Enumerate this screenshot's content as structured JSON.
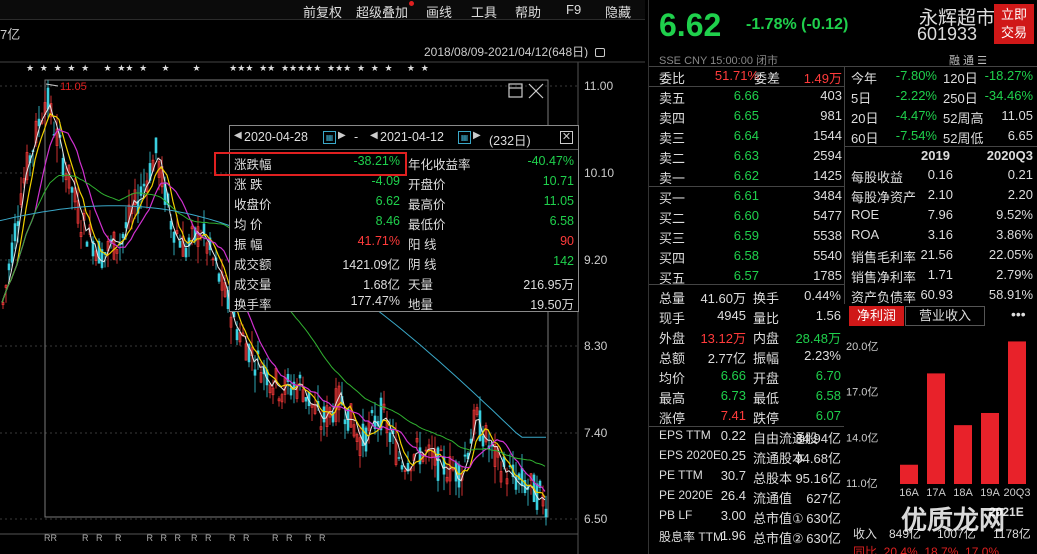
{
  "menu": [
    "前复权",
    "超级叠加",
    "画线",
    "工具",
    "帮助",
    "F9",
    "隐藏"
  ],
  "market_cap_label": "7亿",
  "date_range": "2018/08/09-2021/04/12(648日)",
  "chart": {
    "high_label": "11.05",
    "y_ticks": [
      "11.00",
      "10.10",
      "9.20",
      "8.30",
      "7.40",
      "6.50"
    ],
    "star_markers": "★  ★  ★  ★  ★     ★  ★★  ★     ★        ★          ★★★  ★★  ★★★★★  ★★★  ★  ★  ★     ★  ★",
    "bottom_markers": "RR          R   R     R          R   R   R    R   R       R   R         R   R     R   R"
  },
  "popup": {
    "date_start": "2020-04-28",
    "sep": "-",
    "date_end": "2021-04-12",
    "days": "(232日)",
    "rows": [
      {
        "l1": "涨跌幅",
        "v1": "-38.21%",
        "c1": "g",
        "l2": "年化收益率",
        "v2": "-40.47%",
        "c2": "g"
      },
      {
        "l1": "涨  跌",
        "v1": "-4.09",
        "c1": "g",
        "l2": "开盘价",
        "v2": "10.71",
        "c2": "g"
      },
      {
        "l1": "收盘价",
        "v1": "6.62",
        "c1": "g",
        "l2": "最高价",
        "v2": "11.05",
        "c2": "g"
      },
      {
        "l1": "均  价",
        "v1": "8.46",
        "c1": "g",
        "l2": "最低价",
        "v2": "6.58",
        "c2": "g"
      },
      {
        "l1": "振  幅",
        "v1": "41.71%",
        "c1": "r",
        "l2": "阳  线",
        "v2": "90",
        "c2": "r"
      },
      {
        "l1": "成交额",
        "v1": "1421.09亿",
        "c1": "w",
        "l2": "阴  线",
        "v2": "142",
        "c2": "g"
      },
      {
        "l1": "成交量",
        "v1": "1.68亿",
        "c1": "w",
        "l2": "天量",
        "v2": "216.95万",
        "c2": "w"
      },
      {
        "l1": "换手率",
        "v1": "177.47%",
        "c1": "w",
        "l2": "地量",
        "v2": "19.50万",
        "c2": "w"
      }
    ]
  },
  "quote": {
    "price": "6.62",
    "change": "-1.78% (-0.12)",
    "name": "永辉超市",
    "code": "601933",
    "trade_btn_1": "立即",
    "trade_btn_2": "交易",
    "sub_info": "SSE  CNY  15:00:00  闭市",
    "sub_icons": "融  通  ☰"
  },
  "weibi": {
    "l1": "委比",
    "v1": "51.71%",
    "l2": "委差",
    "v2": "1.49万"
  },
  "sells": [
    {
      "l": "卖五",
      "p": "6.66",
      "v": "403"
    },
    {
      "l": "卖四",
      "p": "6.65",
      "v": "981"
    },
    {
      "l": "卖三",
      "p": "6.64",
      "v": "1544"
    },
    {
      "l": "卖二",
      "p": "6.63",
      "v": "2594"
    },
    {
      "l": "卖一",
      "p": "6.62",
      "v": "1425"
    }
  ],
  "buys": [
    {
      "l": "买一",
      "p": "6.61",
      "v": "3484"
    },
    {
      "l": "买二",
      "p": "6.60",
      "v": "5477"
    },
    {
      "l": "买三",
      "p": "6.59",
      "v": "5538"
    },
    {
      "l": "买四",
      "p": "6.58",
      "v": "5540"
    },
    {
      "l": "买五",
      "p": "6.57",
      "v": "1785"
    }
  ],
  "perf": [
    {
      "l1": "今年",
      "v1": "-7.80%",
      "l2": "120日",
      "v2": "-18.27%"
    },
    {
      "l1": "5日",
      "v1": "-2.22%",
      "l2": "250日",
      "v2": "-34.46%"
    },
    {
      "l1": "20日",
      "v1": "-4.47%",
      "l2": "52周高",
      "v2": "11.05"
    },
    {
      "l1": "60日",
      "v1": "-7.54%",
      "l2": "52周低",
      "v2": "6.65"
    }
  ],
  "fin_header": {
    "y1": "2019",
    "y2": "2020Q3"
  },
  "fin": [
    {
      "l": "每股收益",
      "a": "0.16",
      "b": "0.21"
    },
    {
      "l": "每股净资产",
      "a": "2.10",
      "b": "2.20"
    },
    {
      "l": "ROE",
      "a": "7.96",
      "b": "9.52%"
    },
    {
      "l": "ROA",
      "a": "3.16",
      "b": "3.86%"
    },
    {
      "l": "销售毛利率",
      "a": "21.56",
      "b": "22.05%"
    },
    {
      "l": "销售净利率",
      "a": "1.71",
      "b": "2.79%"
    },
    {
      "l": "资产负债率",
      "a": "60.93",
      "b": "58.91%"
    }
  ],
  "stats": [
    {
      "l1": "总量",
      "v1": "41.60万",
      "c1": "w",
      "l2": "换手",
      "v2": "0.44%",
      "c2": "w"
    },
    {
      "l1": "现手",
      "v1": "4945",
      "c1": "w",
      "l2": "量比",
      "v2": "1.56",
      "c2": "w"
    },
    {
      "l1": "外盘",
      "v1": "13.12万",
      "c1": "r",
      "l2": "内盘",
      "v2": "28.48万",
      "c2": "g"
    },
    {
      "l1": "总额",
      "v1": "2.77亿",
      "c1": "w",
      "l2": "振幅",
      "v2": "2.23%",
      "c2": "w"
    },
    {
      "l1": "均价",
      "v1": "6.66",
      "c1": "g",
      "l2": "开盘",
      "v2": "6.70",
      "c2": "g"
    },
    {
      "l1": "最高",
      "v1": "6.73",
      "c1": "g",
      "l2": "最低",
      "v2": "6.58",
      "c2": "g"
    },
    {
      "l1": "涨停",
      "v1": "7.41",
      "c1": "r",
      "l2": "跌停",
      "v2": "6.07",
      "c2": "g"
    }
  ],
  "valuation": [
    {
      "l1": "EPS TTM",
      "v1": "0.22",
      "l2": "自由流通股",
      "v2": "34.94亿"
    },
    {
      "l1": "EPS 2020E",
      "v1": "0.25",
      "l2": "流通股本",
      "v2": "94.68亿"
    },
    {
      "l1": "PE TTM",
      "v1": "30.7",
      "l2": "总股本",
      "v2": "95.16亿"
    },
    {
      "l1": "PE 2020E",
      "v1": "26.4",
      "l2": "流通值",
      "v2": "627亿"
    },
    {
      "l1": "PB LF",
      "v1": "3.00",
      "l2": "总市值①",
      "v2": "630亿"
    },
    {
      "l1": "股息率 TTM",
      "v1": "1.96",
      "l2": "总市值②",
      "v2": "630亿"
    }
  ],
  "profit_tabs": {
    "active": "净利润",
    "other": "营业收入",
    "more": "•••"
  },
  "bottom_rows": {
    "r1": "2021E",
    "r2_l": "收入",
    "r2_a": "849亿",
    "r2_b": "1007亿",
    "r2_c": "1178亿",
    "r3": "同比  20.4%  18.7%  17.0%"
  },
  "watermark": "优质龙网",
  "chart_data": {
    "type": "bar",
    "categories": [
      "16A",
      "17A",
      "18A",
      "19A",
      "20Q3"
    ],
    "values": [
      12.2,
      18.2,
      14.8,
      15.6,
      20.3
    ],
    "y_ticks": [
      "20.0亿",
      "17.0亿",
      "14.0亿",
      "11.0亿"
    ],
    "ylim": [
      11.0,
      20.0
    ]
  }
}
